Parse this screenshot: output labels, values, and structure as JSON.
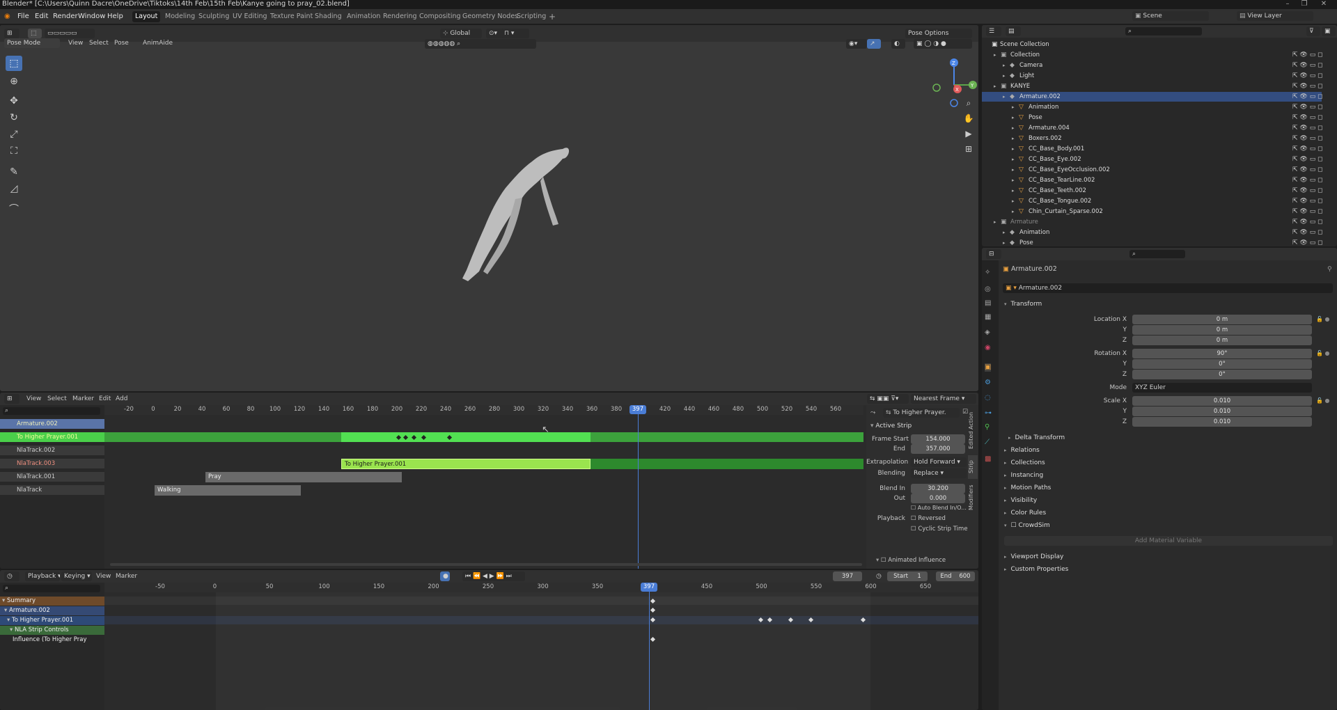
{
  "title": "Blender* [C:\\Users\\Quinn Dacre\\OneDrive\\Tiktoks\\14th Feb\\15th Feb\\Kanye going to pray_02.blend]",
  "menus": [
    "File",
    "Edit",
    "Render",
    "Window",
    "Help"
  ],
  "workspaces": [
    "Layout",
    "Modeling",
    "Sculpting",
    "UV Editing",
    "Texture Paint",
    "Shading",
    "Animation",
    "Rendering",
    "Compositing",
    "Geometry Nodes",
    "Scripting"
  ],
  "active_workspace": "Layout",
  "scene": "Scene",
  "view_layer": "View Layer",
  "viewport": {
    "mode": "Pose Mode",
    "menus": [
      "View",
      "Select",
      "Pose"
    ],
    "addon": "AnimAide",
    "orientation": "Global",
    "pose_options": "Pose Options",
    "gizmo_axes": [
      "X",
      "Y",
      "Z"
    ]
  },
  "nla": {
    "menus": [
      "View",
      "Select",
      "Marker",
      "Edit",
      "Add"
    ],
    "snap": "Nearest Frame",
    "ruler": [
      "-20",
      "0",
      "20",
      "40",
      "60",
      "80",
      "100",
      "120",
      "140",
      "160",
      "180",
      "200",
      "220",
      "240",
      "260",
      "280",
      "300",
      "320",
      "340",
      "360",
      "380",
      "400",
      "420",
      "440",
      "460",
      "480",
      "500",
      "520",
      "540",
      "560"
    ],
    "current_frame": "397",
    "tracks": [
      {
        "name": "Armature.002",
        "style": "object"
      },
      {
        "name": "To Higher Prayer.001",
        "style": "action"
      },
      {
        "name": "NlaTrack.002",
        "style": "track"
      },
      {
        "name": "NlaTrack.003",
        "style": "track-red"
      },
      {
        "name": "NlaTrack.001",
        "style": "track"
      },
      {
        "name": "NlaTrack",
        "style": "track"
      }
    ],
    "strips": {
      "main": "To Higher Prayer.001",
      "pray": "Pray",
      "walking": "Walking"
    },
    "sidebar": {
      "header": "To Higher Prayer.",
      "section": "Active Strip",
      "frame_start_label": "Frame Start",
      "frame_start": "154.000",
      "end_label": "End",
      "end": "357.000",
      "extrapolation_label": "Extrapolation",
      "extrapolation": "Hold Forward",
      "blending_label": "Blending",
      "blending": "Replace",
      "blend_in_label": "Blend In",
      "blend_in": "30.200",
      "out_label": "Out",
      "out": "0.000",
      "auto_blend": "Auto Blend In/O...",
      "playback_label": "Playback",
      "reversed": "Reversed",
      "cyclic": "Cyclic Strip Time",
      "animated_influence": "Animated Influence",
      "tabs": [
        "Edited Action",
        "Strip",
        "Modifiers"
      ]
    }
  },
  "dopesheet": {
    "menus": [
      "Playback",
      "Keying",
      "View",
      "Marker"
    ],
    "current_frame": "397",
    "start_label": "Start",
    "start": "1",
    "end_label": "End",
    "end": "600",
    "ruler": [
      "-50",
      "0",
      "50",
      "100",
      "150",
      "200",
      "250",
      "300",
      "350",
      "400",
      "450",
      "500",
      "550",
      "600",
      "650"
    ],
    "channels": [
      "Summary",
      "Armature.002",
      "To Higher Prayer.001",
      "NLA Strip Controls",
      "Influence (To Higher Pray"
    ]
  },
  "outliner": {
    "root": "Scene Collection",
    "rows": [
      {
        "name": "Collection",
        "indent": 1
      },
      {
        "name": "Camera",
        "indent": 2
      },
      {
        "name": "Light",
        "indent": 2
      },
      {
        "name": "KANYE",
        "indent": 1
      },
      {
        "name": "Armature.002",
        "indent": 2,
        "selected": true
      },
      {
        "name": "Animation",
        "indent": 3
      },
      {
        "name": "Pose",
        "indent": 3
      },
      {
        "name": "Armature.004",
        "indent": 3
      },
      {
        "name": "Boxers.002",
        "indent": 3
      },
      {
        "name": "CC_Base_Body.001",
        "indent": 3
      },
      {
        "name": "CC_Base_Eye.002",
        "indent": 3
      },
      {
        "name": "CC_Base_EyeOcclusion.002",
        "indent": 3
      },
      {
        "name": "CC_Base_TearLine.002",
        "indent": 3
      },
      {
        "name": "CC_Base_Teeth.002",
        "indent": 3
      },
      {
        "name": "CC_Base_Tongue.002",
        "indent": 3
      },
      {
        "name": "Chin_Curtain_Sparse.002",
        "indent": 3
      },
      {
        "name": "Armature",
        "indent": 1,
        "dim": true
      },
      {
        "name": "Animation",
        "indent": 2
      },
      {
        "name": "Pose",
        "indent": 2
      }
    ]
  },
  "properties": {
    "object": "Armature.002",
    "object_field": "Armature.002",
    "transform": "Transform",
    "location_label": "Location X",
    "loc_x": "0 m",
    "loc_y": "0 m",
    "loc_z": "0 m",
    "rotation_label": "Rotation X",
    "rot_x": "90°",
    "rot_y": "0°",
    "rot_z": "0°",
    "mode_label": "Mode",
    "mode": "XYZ Euler",
    "scale_label": "Scale X",
    "scale_x": "0.010",
    "scale_y": "0.010",
    "scale_z": "0.010",
    "y": "Y",
    "z": "Z",
    "delta": "Delta Transform",
    "sections": [
      "Relations",
      "Collections",
      "Instancing",
      "Motion Paths",
      "Visibility",
      "Color Rules"
    ],
    "crowdsim": "CrowdSim",
    "add_material_var": "Add Material Variable",
    "sections2": [
      "Viewport Display",
      "Custom Properties"
    ]
  }
}
